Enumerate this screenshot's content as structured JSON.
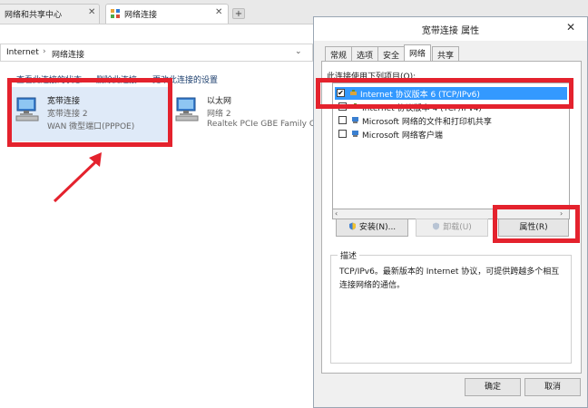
{
  "tabs": [
    {
      "label": "网络和共享中心"
    },
    {
      "label": "网络连接"
    }
  ],
  "address": {
    "root": "Internet",
    "separator": "›",
    "location": "网络连接"
  },
  "toolbar": {
    "view_status": "查看此连接的状态",
    "delete": "删除此连接",
    "change_settings": "更改此连接的设置"
  },
  "connections": [
    {
      "name": "宽带连接",
      "subtitle": "宽带连接  2",
      "device": "WAN 微型端口(PPPOE)"
    },
    {
      "name": "以太网",
      "subtitle": "网络  2",
      "device": "Realtek PCIe GBE Family Con"
    }
  ],
  "dialog": {
    "title": "宽带连接 属性",
    "close": "✕",
    "tabs": [
      "常规",
      "选项",
      "安全",
      "网络",
      "共享"
    ],
    "active_tab": "网络",
    "list_label": "此连接使用下列项目(O):",
    "items": [
      {
        "label": "Internet 协议版本 6 (TCP/IPv6)",
        "checked": true,
        "selected": true
      },
      {
        "label": "Internet 协议版本 4 (TCP/IPv4)",
        "checked": true,
        "selected": false
      },
      {
        "label": "Microsoft 网络的文件和打印机共享",
        "checked": false,
        "selected": false
      },
      {
        "label": "Microsoft 网络客户端",
        "checked": false,
        "selected": false
      }
    ],
    "install_button": "安装(N)...",
    "uninstall_button": "卸载(U)",
    "properties_button": "属性(R)",
    "description_legend": "描述",
    "description_text": "TCP/IPv6。最新版本的 Internet 协议，可提供跨越多个相互连接网络的通信。",
    "ok_button": "确定",
    "cancel_button": "取消"
  },
  "colors": {
    "annotation_red": "#e4222d",
    "selection_blue": "#3399ff"
  }
}
